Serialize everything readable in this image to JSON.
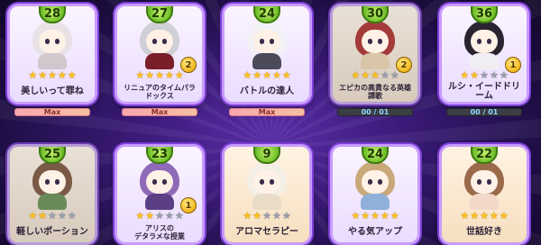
{
  "cards": [
    {
      "level": "28",
      "stars": 5,
      "name": "美しいって罪ね",
      "copies": "",
      "bar": "Max",
      "bar_type": "max",
      "hair": "#e8e2e6",
      "body": "#d2c7cc",
      "theme": "normal",
      "small": false
    },
    {
      "level": "27",
      "stars": 5,
      "name": "リニュアのタイムパラドックス",
      "copies": "2",
      "bar": "Max",
      "bar_type": "max",
      "hair": "#cfcfd6",
      "body": "#7a1f2a",
      "theme": "normal",
      "small": true
    },
    {
      "level": "24",
      "stars": 5,
      "name": "バトルの達人",
      "copies": "",
      "bar": "Max",
      "bar_type": "max",
      "hair": "#f2f2f6",
      "body": "#4a4a58",
      "theme": "normal",
      "small": false
    },
    {
      "level": "30",
      "stars": 3,
      "name": "エピカの高貴なる英雄譚歌",
      "copies": "2",
      "bar": "00 / 01",
      "bar_type": "prog",
      "hair": "#a43a3a",
      "body": "#d9c6a8",
      "theme": "dim",
      "small": true
    },
    {
      "level": "36",
      "stars": 2,
      "name": "ルシ・イードドリーム",
      "copies": "1",
      "bar": "00 / 01",
      "bar_type": "prog",
      "hair": "#2a2430",
      "body": "#f0eef2",
      "theme": "normal",
      "small": false
    },
    {
      "level": "25",
      "stars": 2,
      "name": "軽しいポーション",
      "copies": "",
      "bar": "",
      "bar_type": "",
      "hair": "#7a5a46",
      "body": "#6a8a5a",
      "theme": "dim",
      "small": false
    },
    {
      "level": "23",
      "stars": 2,
      "name": "アリスの\nデタラメな授業",
      "copies": "1",
      "bar": "",
      "bar_type": "",
      "hair": "#8e6ab8",
      "body": "#5a3f84",
      "theme": "normal",
      "small": true
    },
    {
      "level": "9",
      "stars": 2,
      "name": "アロマセラピー",
      "copies": "",
      "bar": "",
      "bar_type": "",
      "hair": "#f4efe6",
      "body": "#e8dcc8",
      "theme": "warm",
      "small": false
    },
    {
      "level": "24",
      "stars": 5,
      "name": "やる気アップ",
      "copies": "",
      "bar": "",
      "bar_type": "",
      "hair": "#c9a87a",
      "body": "#8fb0d8",
      "theme": "normal",
      "small": false
    },
    {
      "level": "22",
      "stars": 5,
      "name": "世話好き",
      "copies": "",
      "bar": "",
      "bar_type": "",
      "hair": "#9a6a4a",
      "body": "#f2d8c8",
      "theme": "warm",
      "small": false
    }
  ],
  "star_glyph": "★"
}
